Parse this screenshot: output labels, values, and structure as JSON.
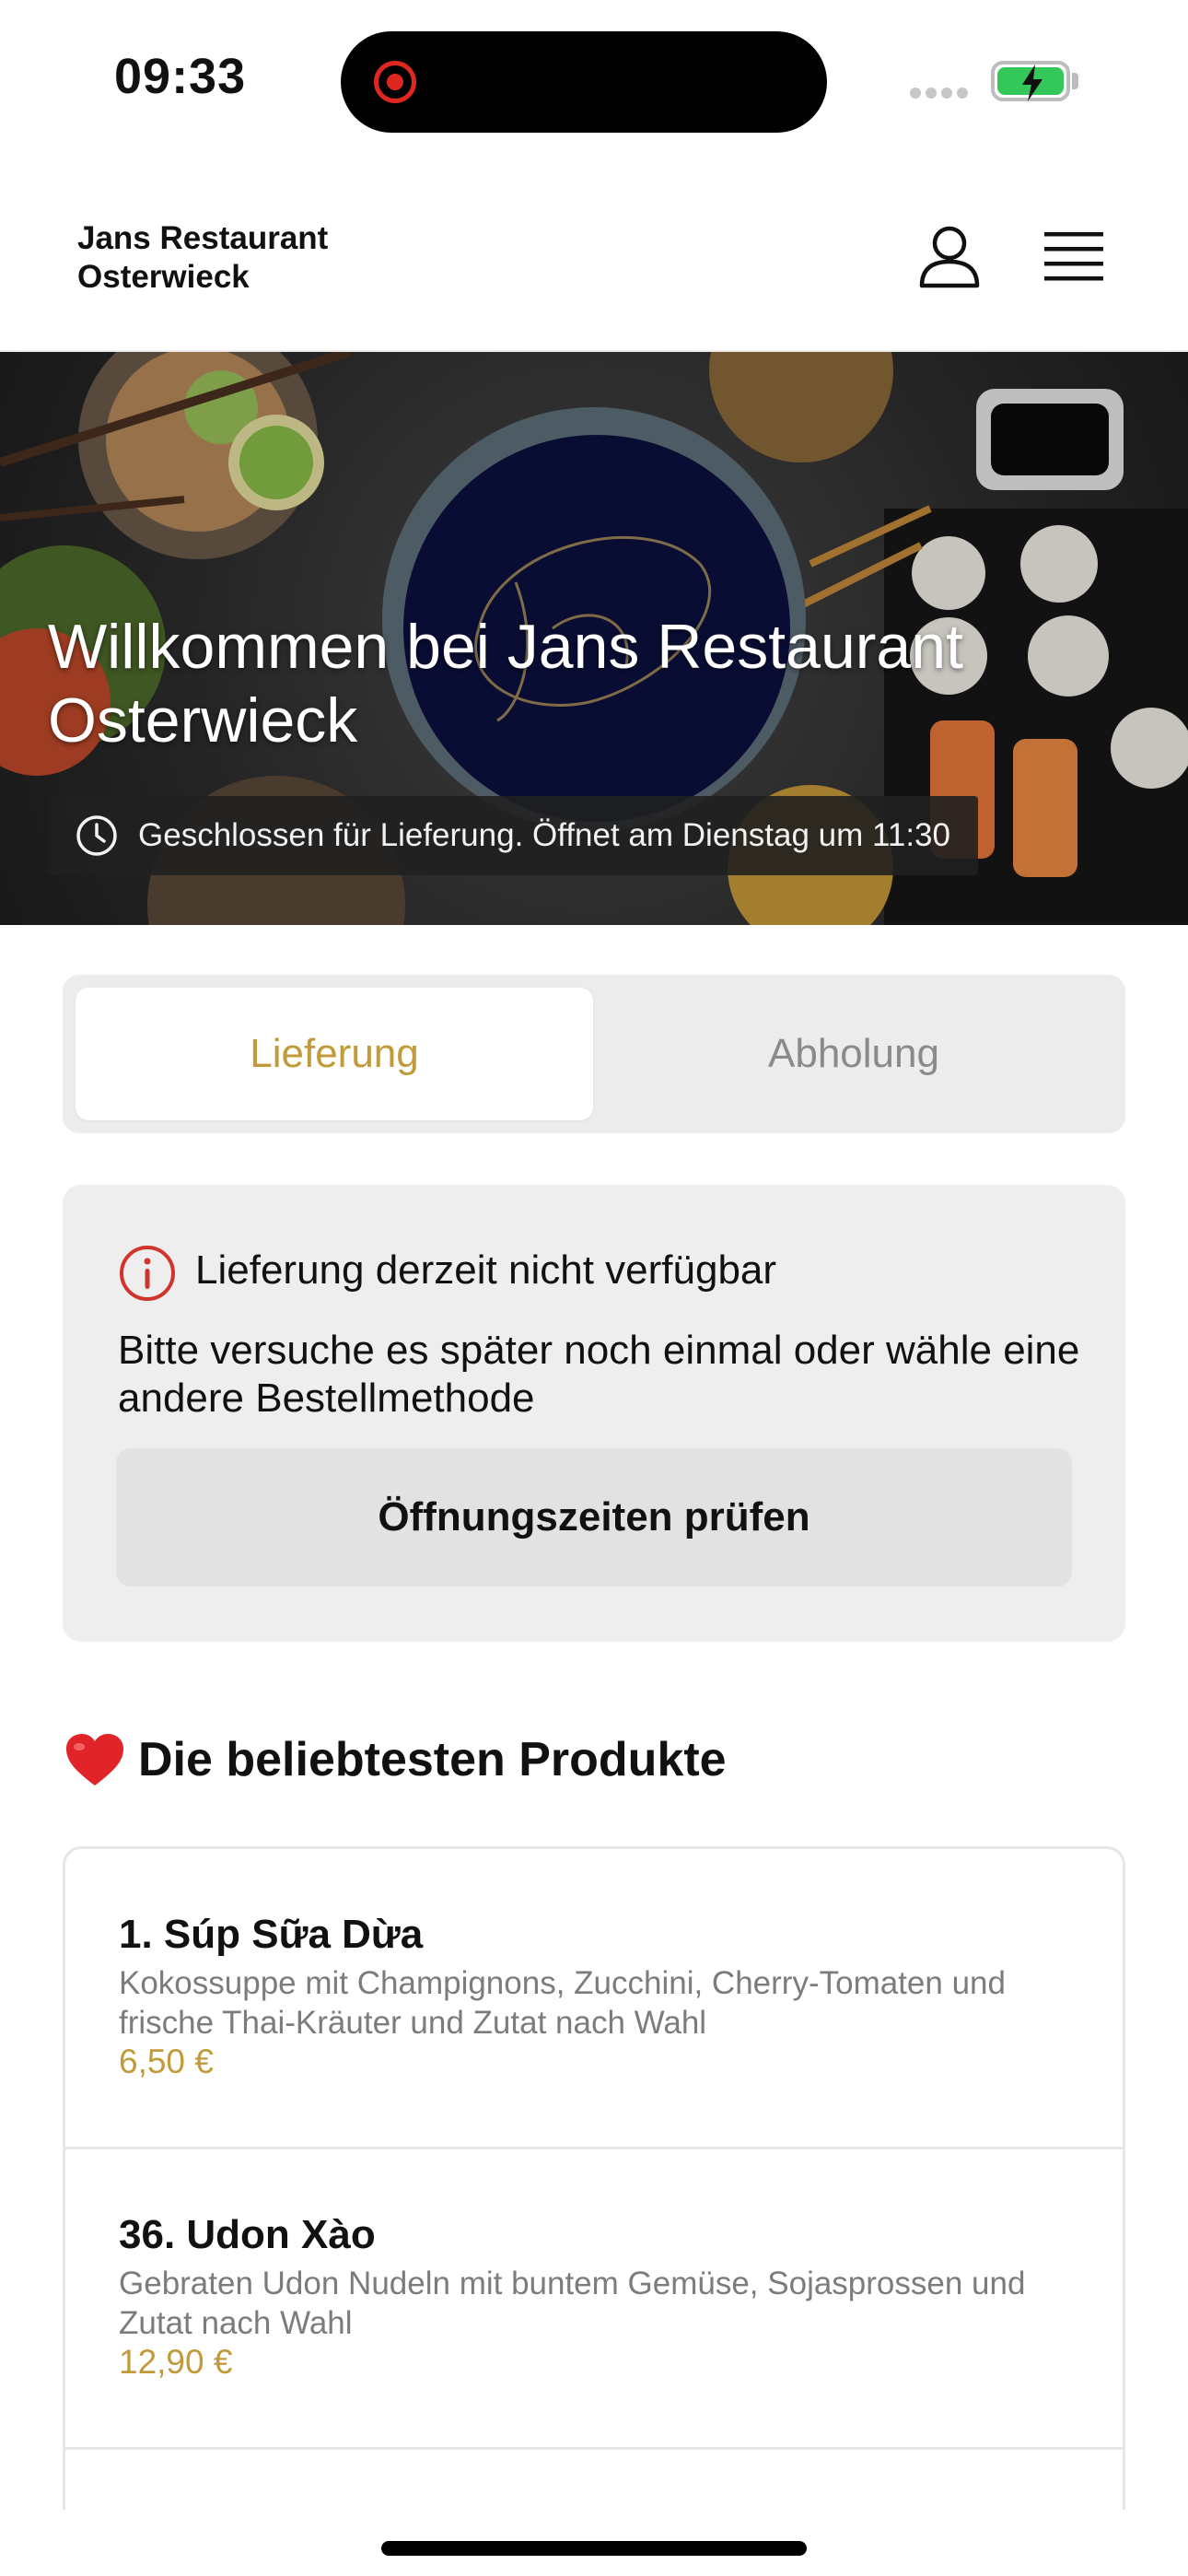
{
  "status_bar": {
    "time": "09:33"
  },
  "header": {
    "brand": "Jans Restaurant\nOsterwieck"
  },
  "hero": {
    "title": "Willkommen bei Jans Restaurant Osterwieck",
    "status": "Geschlossen für Lieferung. Öffnet am Dienstag um 11:30"
  },
  "tabs": [
    {
      "label": "Lieferung",
      "active": true
    },
    {
      "label": "Abholung",
      "active": false
    }
  ],
  "notice": {
    "title": "Lieferung derzeit nicht verfügbar",
    "text": "Bitte versuche es später noch einmal oder wähle eine andere Bestellmethode",
    "button": "Öffnungszeiten prüfen"
  },
  "popular": {
    "heading": "Die beliebtesten Produkte",
    "products": [
      {
        "name": "1. Súp Sữa Dừa",
        "description": "Kokossuppe mit Champignons, Zucchini, Cherry-Tomaten und frische Thai-Kräuter und Zutat nach Wahl",
        "price": "6,50 €"
      },
      {
        "name": "36. Udon Xào",
        "description": "Gebraten Udon Nudeln mit buntem Gemüse, Sojasprossen und Zutat nach Wahl",
        "price": "12,90 €"
      }
    ]
  },
  "colors": {
    "accent": "#c19a3a",
    "hero_overlay": "#202020",
    "notice_bg": "#eeeeee",
    "alert_red": "#d0342c",
    "battery_green": "#34c759"
  },
  "icons": {
    "user": "user-icon",
    "menu": "menu-icon",
    "clock": "clock-icon",
    "alert": "info-circle-icon",
    "heart": "heart-icon"
  }
}
